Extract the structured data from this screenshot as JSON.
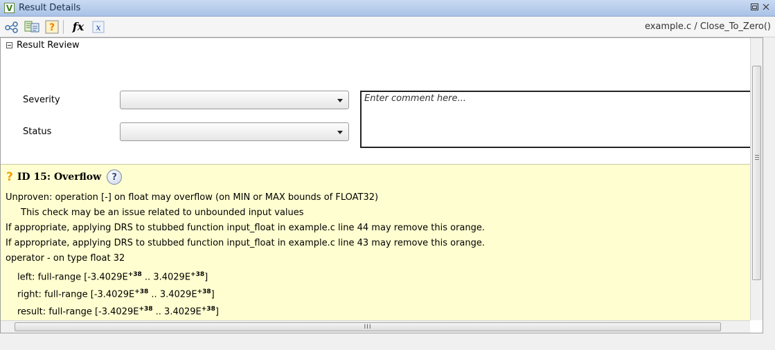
{
  "window": {
    "title": "Result Details",
    "restore_icon": "restore-icon",
    "close_icon": "close-icon"
  },
  "toolbar": {
    "buttons": [
      "call-graph-icon",
      "source-code-icon",
      "help-orange-icon",
      "fx-icon",
      "variable-icon"
    ],
    "fx_label": "fx",
    "breadcrumb": "example.c / Close_To_Zero()"
  },
  "review": {
    "header": "Result Review",
    "severity_label": "Severity",
    "status_label": "Status",
    "severity_value": "",
    "status_value": "",
    "comment_placeholder": "Enter comment here..."
  },
  "result": {
    "icon": "?",
    "id_title": "ID 15: Overflow",
    "lines": [
      "Unproven: operation [-] on float may overflow (on MIN or MAX bounds of FLOAT32)",
      "This check may be an issue related to unbounded input values",
      "If appropriate, applying DRS to stubbed function input_float in example.c line 44 may remove this orange.",
      "If appropriate, applying DRS to stubbed function input_float in example.c line 43 may remove this orange.",
      "operator - on type float 32"
    ],
    "operands": [
      {
        "label": "left:",
        "range_prefix": "full-range [-3.4029E",
        "exp1": "+38",
        "mid": " .. 3.4029E",
        "exp2": "+38",
        "suffix": "]"
      },
      {
        "label": "right:",
        "range_prefix": "full-range [-3.4029E",
        "exp1": "+38",
        "mid": " .. 3.4029E",
        "exp2": "+38",
        "suffix": "]"
      },
      {
        "label": "result:",
        "range_prefix": "full-range [-3.4029E",
        "exp1": "+38",
        "mid": " .. 3.4029E",
        "exp2": "+38",
        "suffix": "]"
      }
    ]
  },
  "colors": {
    "titlebar": "#b7cdee",
    "result_bg": "#fffed0",
    "warning": "#f0a000"
  }
}
